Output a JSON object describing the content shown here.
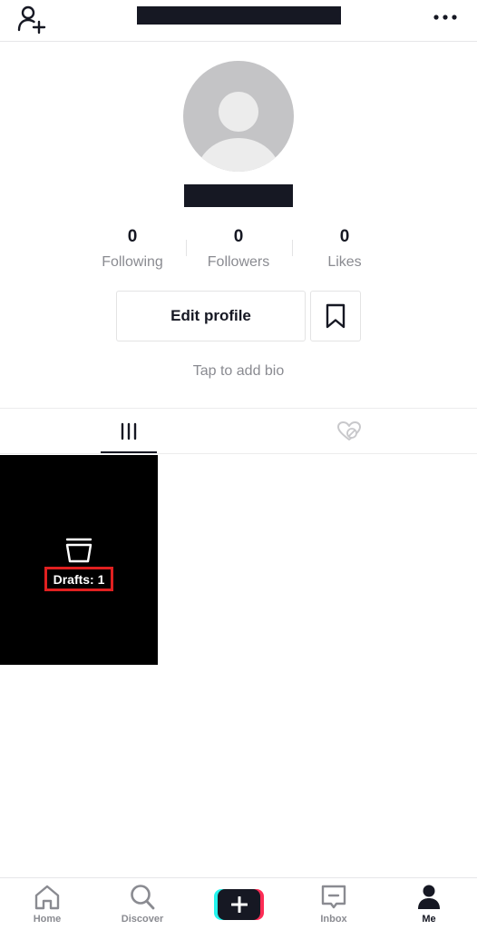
{
  "header": {
    "add_user_icon": "person-add-icon",
    "more_icon": "more-horizontal-icon"
  },
  "profile": {
    "avatar_icon": "default-avatar-icon",
    "stats": [
      {
        "value": "0",
        "label": "Following"
      },
      {
        "value": "0",
        "label": "Followers"
      },
      {
        "value": "0",
        "label": "Likes"
      }
    ],
    "edit_button_label": "Edit profile",
    "bookmark_icon": "bookmark-icon",
    "bio_placeholder": "Tap to add bio"
  },
  "tabs": {
    "videos_icon": "grid-bars-icon",
    "liked_icon": "hidden-heart-icon",
    "active": "videos"
  },
  "drafts": {
    "icon": "drafts-bin-icon",
    "label": "Drafts: 1"
  },
  "bottom_nav": {
    "items": [
      {
        "label": "Home",
        "icon": "home-icon"
      },
      {
        "label": "Discover",
        "icon": "search-icon"
      },
      {
        "label": "",
        "icon": "plus-icon"
      },
      {
        "label": "Inbox",
        "icon": "inbox-icon"
      },
      {
        "label": "Me",
        "icon": "person-icon"
      }
    ],
    "active": "Me"
  },
  "colors": {
    "text_primary": "#161823",
    "text_secondary": "#8a8b91",
    "accent_cyan": "#25f4ee",
    "accent_red": "#fe2c55",
    "highlight_box": "#e02020"
  }
}
